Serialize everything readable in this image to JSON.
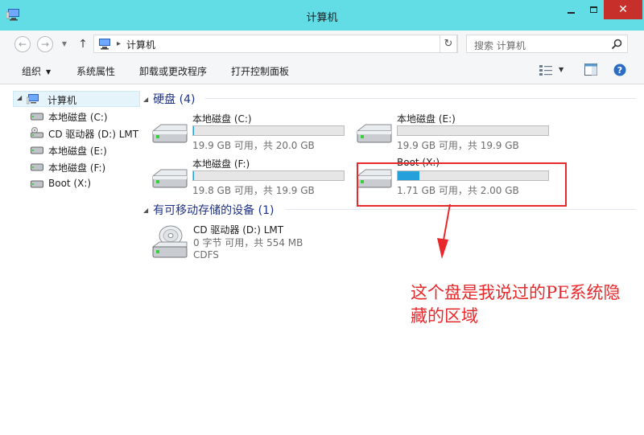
{
  "window": {
    "title": "计算机",
    "close_glyph": "✕"
  },
  "nav": {
    "back_glyph": "←",
    "forward_glyph": "→",
    "up_glyph": "↑",
    "refresh_glyph": "↻"
  },
  "address": {
    "separator": "▸",
    "path": "计算机"
  },
  "search": {
    "placeholder": "搜索 计算机"
  },
  "toolbar": {
    "organize": "组织",
    "system_properties": "系统属性",
    "uninstall": "卸载或更改程序",
    "control_panel": "打开控制面板"
  },
  "sidebar": {
    "root": "计算机",
    "items": [
      {
        "label": "本地磁盘 (C:)",
        "icon": "hard-drive-icon"
      },
      {
        "label": "CD 驱动器 (D:) LMT",
        "icon": "cd-drive-icon"
      },
      {
        "label": "本地磁盘 (E:)",
        "icon": "hard-drive-icon"
      },
      {
        "label": "本地磁盘 (F:)",
        "icon": "hard-drive-icon"
      },
      {
        "label": "Boot (X:)",
        "icon": "hard-drive-icon"
      }
    ]
  },
  "groups": {
    "hard_disks": "硬盘 (4)",
    "removable": "有可移动存储的设备 (1)"
  },
  "drives": [
    {
      "name": "本地磁盘 (C:)",
      "free": "19.9 GB 可用，共 20.0 GB",
      "used_fraction": 0.005
    },
    {
      "name": "本地磁盘 (E:)",
      "free": "19.9 GB 可用，共 19.9 GB",
      "used_fraction": 0.0
    },
    {
      "name": "本地磁盘 (F:)",
      "free": "19.8 GB 可用，共 19.9 GB",
      "used_fraction": 0.005
    },
    {
      "name": "Boot (X:)",
      "free": "1.71 GB 可用，共 2.00 GB",
      "used_fraction": 0.145
    }
  ],
  "cd_drive": {
    "name": "CD 驱动器 (D:) LMT",
    "free": "0 字节 可用，共 554 MB",
    "filesystem": "CDFS"
  },
  "annotation": {
    "text": "这个盘是我说过的PE系统隐藏的区域",
    "color": "#e8282b"
  },
  "colors": {
    "titlebar": "#62dde6",
    "accent_bar": "#26a0da",
    "group_header": "#1e3287"
  }
}
